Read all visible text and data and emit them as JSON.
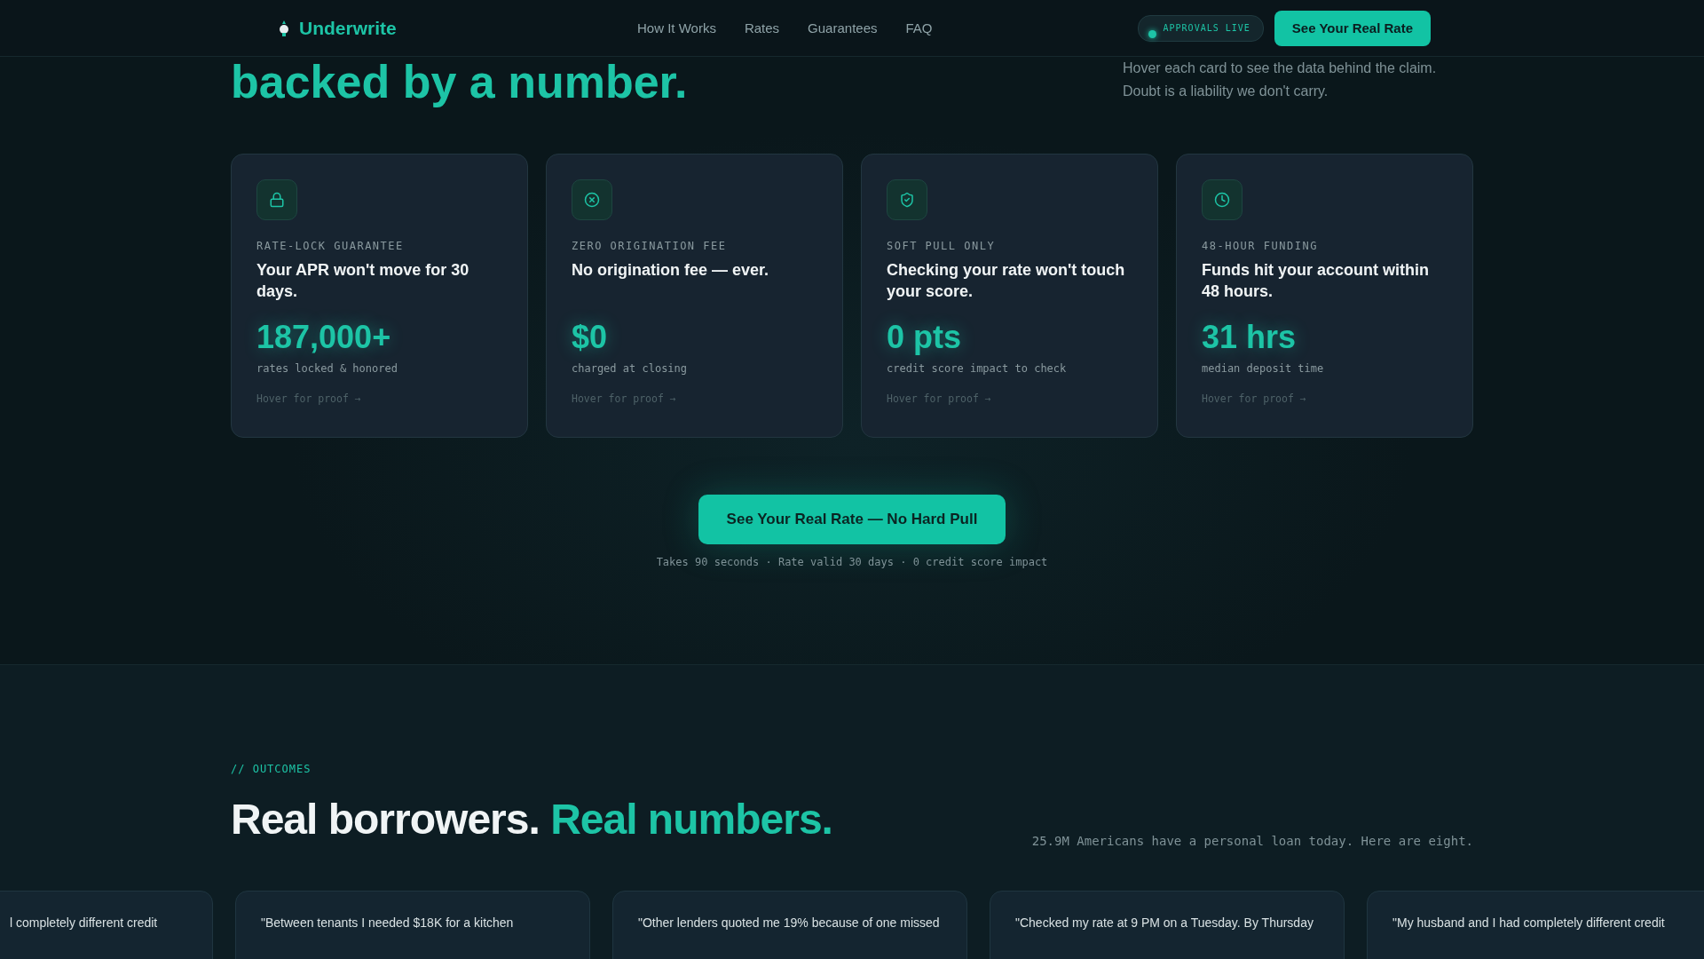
{
  "nav": {
    "brand": "Underwrite",
    "links": [
      "How It Works",
      "Rates",
      "Guarantees",
      "FAQ"
    ],
    "badge": "APPROVALS LIVE",
    "cta": "See Your Real Rate"
  },
  "hero": {
    "headline": "backed by a number.",
    "intro": [
      "Hover each card to see the data behind the claim.",
      "Doubt is a liability we don't carry."
    ]
  },
  "guarantees": [
    {
      "eyebrow": "RATE-LOCK GUARANTEE",
      "claim": "Your APR won't move for 30 days.",
      "stat": "187,000+",
      "stat_label": "rates locked & honored",
      "hint": "Hover for proof →"
    },
    {
      "eyebrow": "ZERO ORIGINATION FEE",
      "claim": "No origination fee — ever.",
      "stat": "$0",
      "stat_label": "charged at closing",
      "hint": "Hover for proof →"
    },
    {
      "eyebrow": "SOFT PULL ONLY",
      "claim": "Checking your rate won't touch your score.",
      "stat": "0 pts",
      "stat_label": "credit score impact to check",
      "hint": "Hover for proof →"
    },
    {
      "eyebrow": "48-HOUR FUNDING",
      "claim": "Funds hit your account within 48 hours.",
      "stat": "31 hrs",
      "stat_label": "median deposit time",
      "hint": "Hover for proof →"
    }
  ],
  "cta": {
    "button": "See Your Real Rate — No Hard Pull",
    "caption": "Takes 90 seconds · Rate valid 30 days · 0 credit score impact"
  },
  "outcomes": {
    "eyebrow": "// OUTCOMES",
    "title": "Real borrowers.",
    "title_accent": "Real numbers.",
    "note": "25.9M Americans have a personal loan today. Here are eight.",
    "testimonials": [
      "l completely different credit",
      "\"Between tenants I needed $18K for a kitchen",
      "\"Other lenders quoted me 19% because of one missed",
      "\"Checked my rate at 9 PM on a Tuesday. By Thursday",
      "\"My husband and I had completely different credit"
    ]
  }
}
